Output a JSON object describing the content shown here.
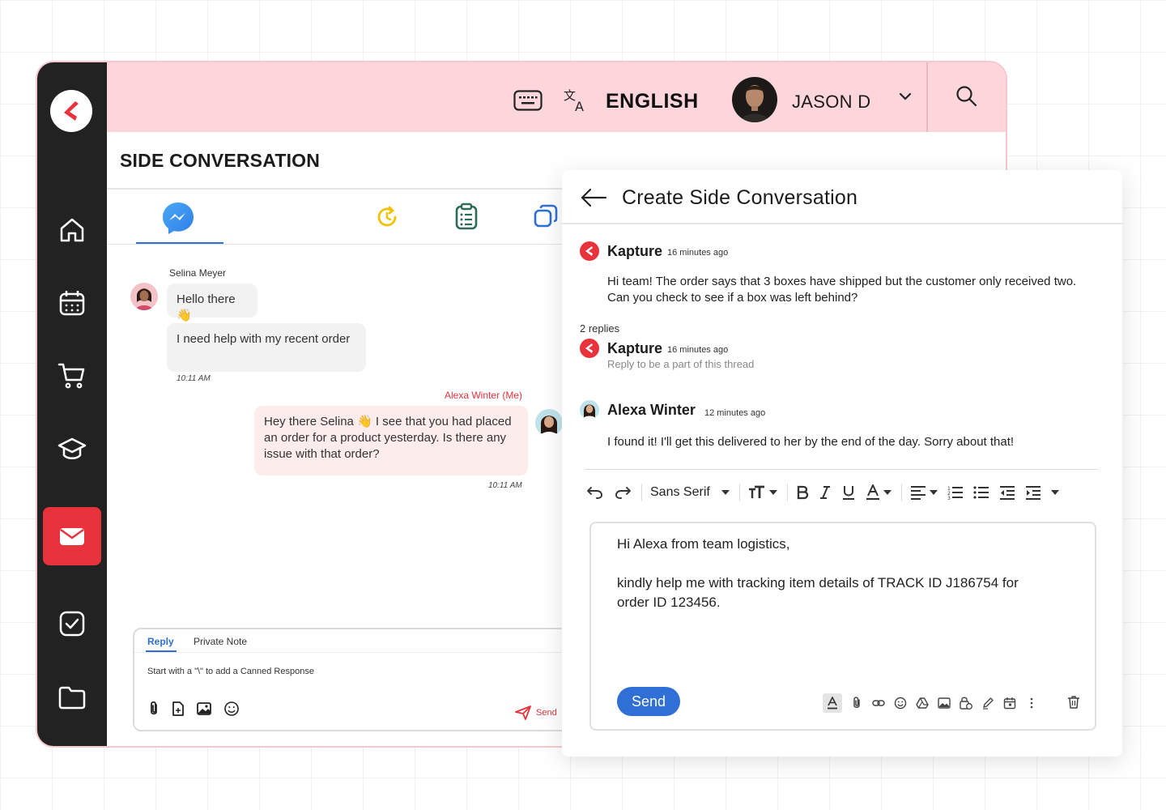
{
  "header": {
    "language": "ENGLISH",
    "user_name": "JASON D"
  },
  "page": {
    "title": "SIDE CONVERSATION"
  },
  "chat": {
    "customer_name": "Selina Meyer",
    "msg1": "Hello there 👋",
    "msg2": "I need help with my recent order",
    "msg2_time": "10:11 AM",
    "agent_name": "Alexa Winter (Me)",
    "msg3": "Hey there Selina 👋 I see that you had placed an order for a product yesterday. Is there any issue with that order?",
    "msg3_time": "10:11 AM"
  },
  "composer": {
    "tab_reply": "Reply",
    "tab_private": "Private Note",
    "placeholder": "Start with a \"\\\" to add a Canned Response",
    "send_label": "Send"
  },
  "panel": {
    "title": "Create Side Conversation",
    "thread": {
      "author": "Kapture",
      "time": "16 minutes ago",
      "message": "Hi team! The order says that 3 boxes have shipped but the customer only received two. Can you check to see if a box was left behind?",
      "replies_count": "2 replies"
    },
    "reply1": {
      "author": "Kapture",
      "time": "16 minutes ago",
      "sub": "Reply to be a part of this thread"
    },
    "reply2": {
      "author": "Alexa Winter",
      "time": "12 minutes ago",
      "message": "I found it! I'll get this delivered to her by the end of the day. Sorry about that!"
    },
    "toolbar": {
      "font": "Sans Serif"
    },
    "editor": {
      "line1": "Hi Alexa from team logistics,",
      "line2": "kindly help me with tracking item details of TRACK ID J186754 for order ID 123456."
    },
    "send_label": "Send"
  },
  "colors": {
    "brand_red": "#e8323c",
    "topbar_pink": "#fdd6dc",
    "sidebar_dark": "#222222",
    "accent_blue": "#2f6fd6"
  }
}
